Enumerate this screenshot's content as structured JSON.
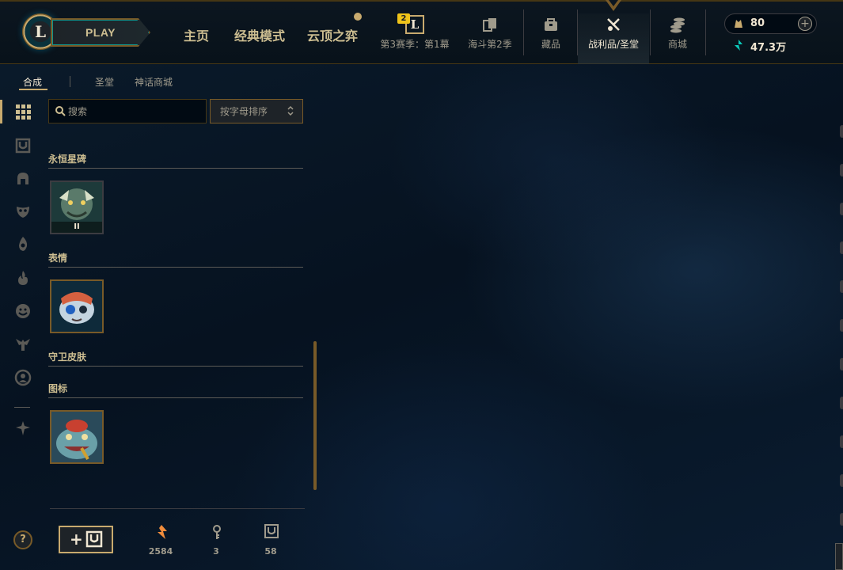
{
  "header": {
    "logo_letter": "L",
    "play_label": "PLAY",
    "nav": [
      "主页",
      "经典模式",
      "云顶之弈"
    ],
    "season": {
      "badge": "2",
      "letter": "L",
      "label": "第3赛季：第1幕"
    },
    "sub_nav": [
      {
        "label": "海斗第2季",
        "icon": "clash-cards-icon"
      },
      {
        "label": "藏品",
        "icon": "collection-bag-icon"
      },
      {
        "label": "战利品/圣堂",
        "icon": "loot-icon",
        "active": true
      },
      {
        "label": "商城",
        "icon": "store-coins-icon"
      }
    ],
    "rp": "80",
    "blue_essence": "47.3万",
    "plus": "+"
  },
  "tabs": [
    "合成",
    "圣堂",
    "神话商城"
  ],
  "search": {
    "placeholder": "搜索"
  },
  "sort": {
    "label": "按字母排序"
  },
  "sections": [
    {
      "title": "永恒星碑",
      "items": [
        {
          "name": "eternal-renekton",
          "badge": "II"
        }
      ]
    },
    {
      "title": "表情",
      "items": [
        {
          "name": "emote-poro"
        }
      ]
    },
    {
      "title": "守卫皮肤",
      "items": []
    },
    {
      "title": "图标",
      "items": [
        {
          "name": "icon-tahm"
        }
      ]
    }
  ],
  "bottom": {
    "craft_plus": "+",
    "orange_essence": "2584",
    "keys": "3",
    "chests": "58"
  },
  "help": "?",
  "colors": {
    "gold": "#c8aa6e",
    "gold_dark": "#785a28",
    "text": "#a09b8c",
    "text_light": "#f0e6d2",
    "teal": "#0ac8b9",
    "orange": "#f08c3c",
    "bg": "#010a13"
  }
}
